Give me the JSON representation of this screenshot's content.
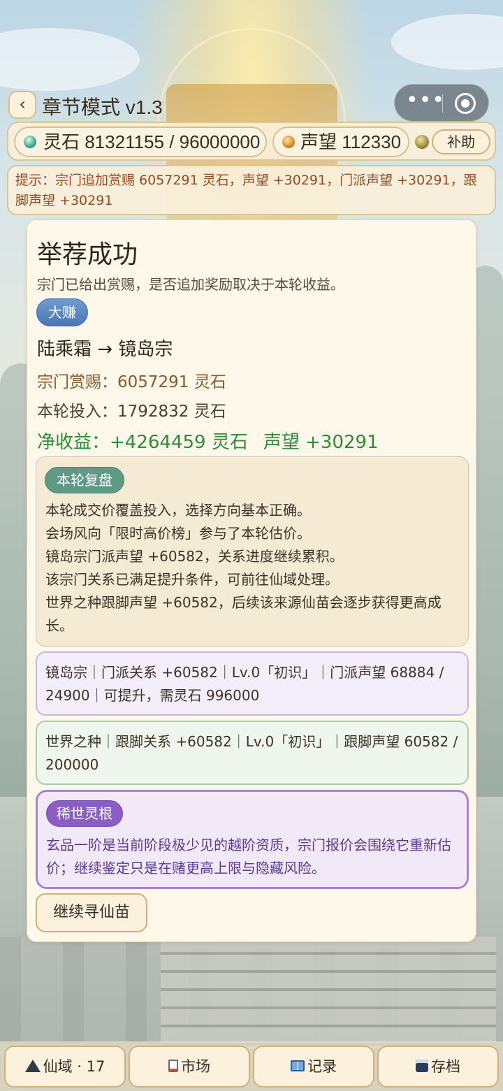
{
  "header": {
    "back_label": "‹",
    "title": "章节模式 v1.3"
  },
  "stats": {
    "stone_label": "灵石 81321155 / 96000000",
    "fame_label": "声望 112330",
    "aid_label": "补助"
  },
  "hint": "提示：宗门追加赏赐 6057291 灵石，声望 +30291，门派声望 +30291，跟脚声望 +30291",
  "result": {
    "title": "举荐成功",
    "subtitle": "宗门已给出赏赐，是否追加奖励取决于本轮收益。",
    "badge": "大赚",
    "match": "陆乘霜 → 镜岛宗",
    "reward": "宗门赏赐：6057291 灵石",
    "invest": "本轮投入：1792832 灵石",
    "net_gain": "净收益：+4264459 灵石",
    "net_fame": "声望 +30291"
  },
  "review": {
    "badge": "本轮复盘",
    "lines": [
      "本轮成交价覆盖投入，选择方向基本正确。",
      "会场风向「限时高价榜」参与了本轮估价。",
      "镜岛宗门派声望 +60582，关系进度继续累积。",
      "该宗门关系已满足提升条件，可前往仙域处理。",
      "世界之种跟脚声望 +60582，后续该来源仙苗会逐步获得更高成长。"
    ]
  },
  "sect_relation": "镜岛宗｜门派关系 +60582｜Lv.0「初识」｜门派声望 68884 / 24900｜可提升，需灵石 996000",
  "world_relation": "世界之种｜跟脚关系 +60582｜Lv.0「初识」｜跟脚声望 60582 / 200000",
  "rare": {
    "badge": "稀世灵根",
    "text": "玄品一阶是当前阶段极少见的越阶资质，宗门报价会围绕它重新估价；继续鉴定只是在赌更高上限与隐藏风险。"
  },
  "continue_label": "继续寻仙苗",
  "nav": {
    "realm": "仙域 · 17",
    "market": "市场",
    "records": "记录",
    "save": "存档"
  }
}
